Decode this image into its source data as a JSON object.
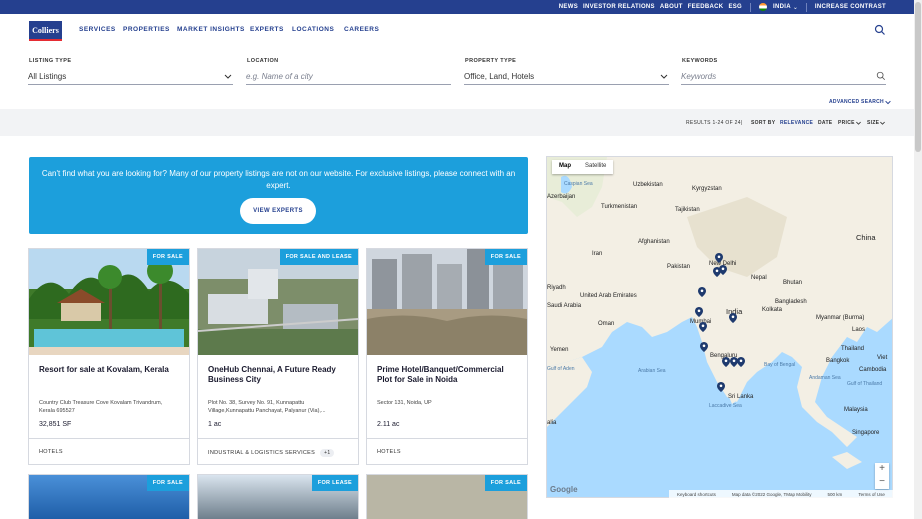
{
  "utility": {
    "links": [
      "NEWS",
      "INVESTOR RELATIONS",
      "ABOUT",
      "FEEDBACK",
      "ESG"
    ],
    "country": "INDIA",
    "contrast": "INCREASE CONTRAST"
  },
  "brand": {
    "logo_text": "Colliers"
  },
  "nav": {
    "items": [
      "SERVICES",
      "PROPERTIES",
      "MARKET INSIGHTS",
      "EXPERTS",
      "LOCATIONS",
      "CAREERS"
    ]
  },
  "search": {
    "listing_type_label": "LISTING TYPE",
    "listing_type_value": "All Listings",
    "location_label": "LOCATION",
    "location_placeholder": "e.g. Name of a city",
    "property_type_label": "PROPERTY TYPE",
    "property_type_value": "Office, Land, Hotels",
    "keywords_label": "KEYWORDS",
    "keywords_placeholder": "Keywords",
    "advanced": "ADVANCED SEARCH"
  },
  "results": {
    "count": "RESULTS 1-24 OF 24",
    "sep": "|",
    "sort_by": "SORT BY",
    "sort_options": [
      "RELEVANCE",
      "DATE",
      "PRICE",
      "SIZE"
    ]
  },
  "cta": {
    "text": "Can't find what you are looking for? Many of our property listings are not on our website. For exclusive listings, please connect with an expert.",
    "button": "VIEW EXPERTS"
  },
  "cards": [
    {
      "badge": "FOR SALE",
      "title": "Resort for sale at Kovalam, Kerala",
      "address": "Country Club Treasure Cove Kovalam Trivandrum, Kerala 695527",
      "size": "32,851 SF",
      "tag": "HOTELS",
      "extra": ""
    },
    {
      "badge": "FOR SALE AND LEASE",
      "title": "OneHub Chennai, A Future Ready Business City",
      "address": "Plot No. 38, Survey No. 91, Kunnapattu Village,Kunnapattu Panchayat, Palyanur (Via),...",
      "size": "1 ac",
      "tag": "INDUSTRIAL & LOGISTICS SERVICES",
      "extra": "+1"
    },
    {
      "badge": "FOR SALE",
      "title": "Prime Hotel/Banquet/Commercial Plot for Sale in Noida",
      "address": "Sector 131, Noida, UP",
      "size": "2.11 ac",
      "tag": "HOTELS",
      "extra": ""
    }
  ],
  "cards_row2": [
    {
      "badge": "FOR SALE"
    },
    {
      "badge": "FOR LEASE"
    },
    {
      "badge": "FOR SALE"
    }
  ],
  "map": {
    "tabs": [
      "Map",
      "Satellite"
    ],
    "labels": {
      "uzbekistan": "Uzbekistan",
      "kyrgyzstan": "Kyrgyzstan",
      "azerbaijan": "Azerbaijan",
      "turkmenistan": "Turkmenistan",
      "tajikistan": "Tajikistan",
      "china": "China",
      "afghanistan": "Afghanistan",
      "iran": "Iran",
      "pakistan": "Pakistan",
      "new_delhi": "New Delhi",
      "nepal": "Nepal",
      "bhutan": "Bhutan",
      "riyadh": "Riyadh",
      "uae": "United Arab Emirates",
      "saudi": "Saudi Arabia",
      "bangladesh": "Bangladesh",
      "india": "India",
      "kolkata": "Kolkata",
      "oman": "Oman",
      "myanmar": "Myanmar (Burma)",
      "laos": "Laos",
      "mumbai": "Mumbai",
      "yemen": "Yemen",
      "thailand": "Thailand",
      "arabian_sea": "Arabian Sea",
      "bay_bengal": "Bay of Bengal",
      "bangkok": "Bangkok",
      "cambodia": "Cambodia",
      "andaman": "Andaman Sea",
      "sri_lanka": "Sri Lanka",
      "laccadive": "Laccadive Sea",
      "malaysia": "Malaysia",
      "singapore": "Singapore",
      "somalia": "alia",
      "gulf_aden": "Gulf of Aden",
      "caspian": "Caspian Sea",
      "viet": "Viet",
      "gulf_thai": "Gulf of Thailand",
      "bengaluru": "Bengaluru"
    },
    "zoom_in": "+",
    "zoom_out": "−",
    "footer": [
      "Keyboard shortcuts",
      "Map data ©2022 Google, TMap Mobility",
      "500 km",
      "Terms of Use"
    ],
    "google": "Google"
  },
  "colors": {
    "brand_navy": "#25408f",
    "accent_blue": "#1c9fdc",
    "brand_red": "#e52c33"
  }
}
